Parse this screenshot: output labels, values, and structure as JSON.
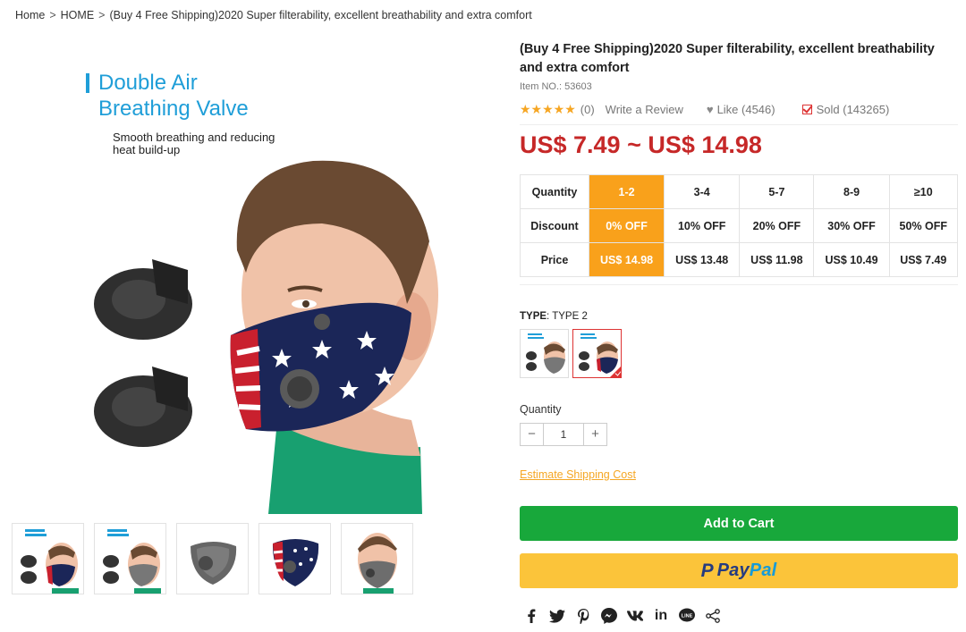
{
  "breadcrumb": {
    "items": [
      "Home",
      "HOME",
      "(Buy 4 Free Shipping)2020 Super filterability, excellent breathability and extra comfort"
    ],
    "separator": ">"
  },
  "hero": {
    "title_line1": "Double Air",
    "title_line2": "Breathing Valve",
    "subtitle_line1": "Smooth breathing and reducing",
    "subtitle_line2": "heat build-up"
  },
  "product": {
    "title": "(Buy 4 Free Shipping)2020 Super filterability, excellent breathability and extra comfort",
    "item_no": "Item NO.: 53603",
    "stars": "★★★★★",
    "review_count": "(0)",
    "write_review": "Write a Review",
    "like": "Like (4546)",
    "sold": "Sold (143265)",
    "price_range": "US$ 7.49 ~ US$ 14.98"
  },
  "tiers": {
    "row_labels": [
      "Quantity",
      "Discount",
      "Price"
    ],
    "quantity": [
      "1-2",
      "3-4",
      "5-7",
      "8-9",
      "≥10"
    ],
    "discount": [
      "0% OFF",
      "10% OFF",
      "20% OFF",
      "30% OFF",
      "50% OFF"
    ],
    "price": [
      "US$ 14.98",
      "US$ 13.48",
      "US$ 11.98",
      "US$ 10.49",
      "US$ 7.49"
    ],
    "active_index": 0
  },
  "type": {
    "label": "TYPE",
    "value": ": TYPE 2",
    "selected_index": 1
  },
  "quantity": {
    "label": "Quantity",
    "value": "1",
    "minus": "−",
    "plus": "+"
  },
  "shipping_link": "Estimate Shipping Cost",
  "add_to_cart": "Add to Cart",
  "paypal": {
    "pay": "Pay",
    "pal": "Pal",
    "p": "P"
  },
  "share_icons": [
    "facebook-icon",
    "twitter-icon",
    "pinterest-icon",
    "messenger-icon",
    "vk-icon",
    "linkedin-icon",
    "line-icon",
    "share-icon"
  ],
  "colors": {
    "accent_orange": "#f9a11b",
    "price_red": "#c62828",
    "cart_green": "#18a83b",
    "paypal_yellow": "#fbc43a",
    "hero_blue": "#1f9ed8"
  }
}
